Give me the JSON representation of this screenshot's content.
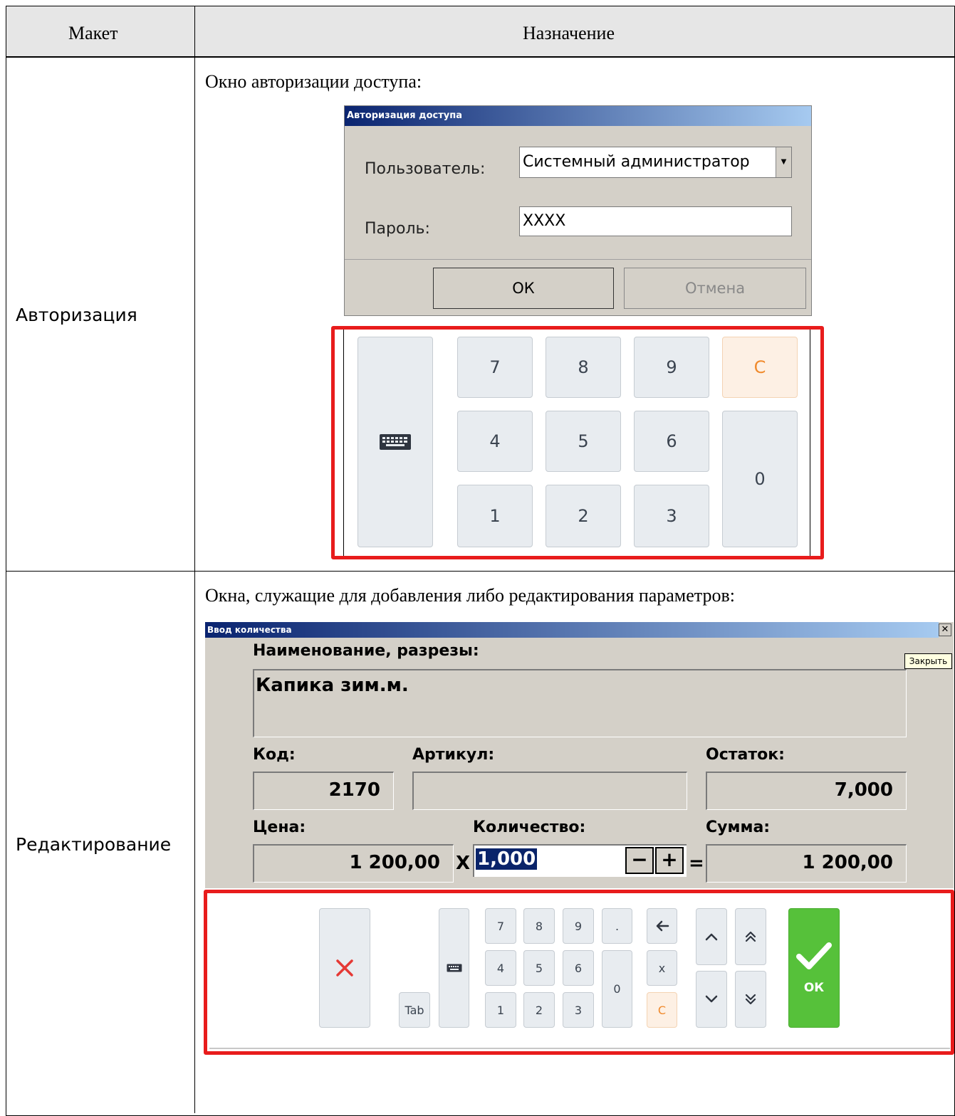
{
  "table": {
    "col_layout": "Макет",
    "col_purpose": "Назначение"
  },
  "rows": [
    {
      "name": "Авторизация",
      "description": "Окно авторизации доступа:",
      "dialog": {
        "title": "Авторизация доступа",
        "user_label": "Пользователь:",
        "user_value": "Системный администратор",
        "password_label": "Пароль:",
        "password_value": "XXXX",
        "ok_label": "ОК",
        "cancel_label": "Отмена"
      },
      "keypad": {
        "keys": [
          "7",
          "8",
          "9",
          "С",
          "4",
          "5",
          "6",
          "0",
          "1",
          "2",
          "3"
        ],
        "keyboard_icon": "keyboard-icon"
      }
    },
    {
      "name": "Редактирование",
      "description": "Окна, служащие для добавления либо редактирования параметров:",
      "dialog": {
        "title": "Ввод количества",
        "close_tooltip": "Закрыть",
        "name_label": "Наименование, разрезы:",
        "name_value": "Капика зим.м.",
        "code_label": "Код:",
        "code_value": "2170",
        "article_label": "Артикул:",
        "article_value": "",
        "stock_label": "Остаток:",
        "stock_value": "7,000",
        "price_label": "Цена:",
        "price_value": "1 200,00",
        "qty_label": "Количество:",
        "qty_value": "1,000",
        "sum_label": "Сумма:",
        "sum_value": "1 200,00",
        "multiply_sign": "X",
        "equals_sign": "=",
        "minus": "−",
        "plus": "+"
      },
      "keypad": {
        "tab_label": "Tab",
        "digits": [
          "7",
          "8",
          "9",
          "4",
          "5",
          "6",
          "1",
          "2",
          "3"
        ],
        "dot": ".",
        "zero": "0",
        "x_label": "x",
        "clear_label": "С",
        "ok_label": "ОК"
      }
    }
  ]
}
